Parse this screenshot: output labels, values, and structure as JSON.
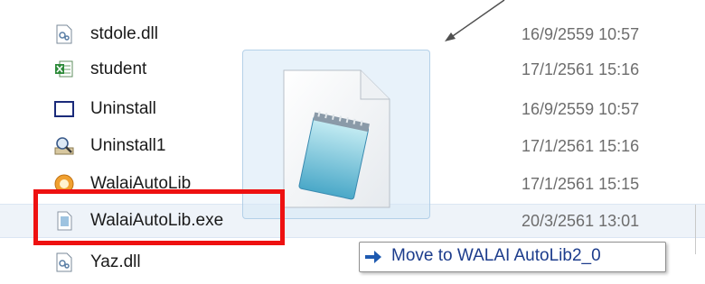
{
  "files": [
    {
      "name": "stdole.dll",
      "date": "16/9/2559 10:57",
      "icon": "dll-icon"
    },
    {
      "name": "student",
      "date": "17/1/2561 15:16",
      "icon": "excel-icon"
    },
    {
      "name": "Uninstall",
      "date": "16/9/2559 10:57",
      "icon": "window-icon"
    },
    {
      "name": "Uninstall1",
      "date": "17/1/2561 15:16",
      "icon": "uninstall-icon"
    },
    {
      "name": "WalaiAutoLib",
      "date": "17/1/2561 15:15",
      "icon": "app-icon"
    },
    {
      "name": "WalaiAutoLib.exe",
      "date": "20/3/2561 13:01",
      "icon": "exe-icon",
      "selected": true
    },
    {
      "name": "Yaz.dll",
      "date": "",
      "icon": "dll-icon"
    }
  ],
  "tooltip": {
    "text": "Move to WALAI AutoLib2_0",
    "icon": "move-arrow-icon"
  },
  "colors": {
    "highlight": "#ee1111",
    "tooltip_text": "#1c3c8c",
    "selected_row": "#eef3f9"
  }
}
